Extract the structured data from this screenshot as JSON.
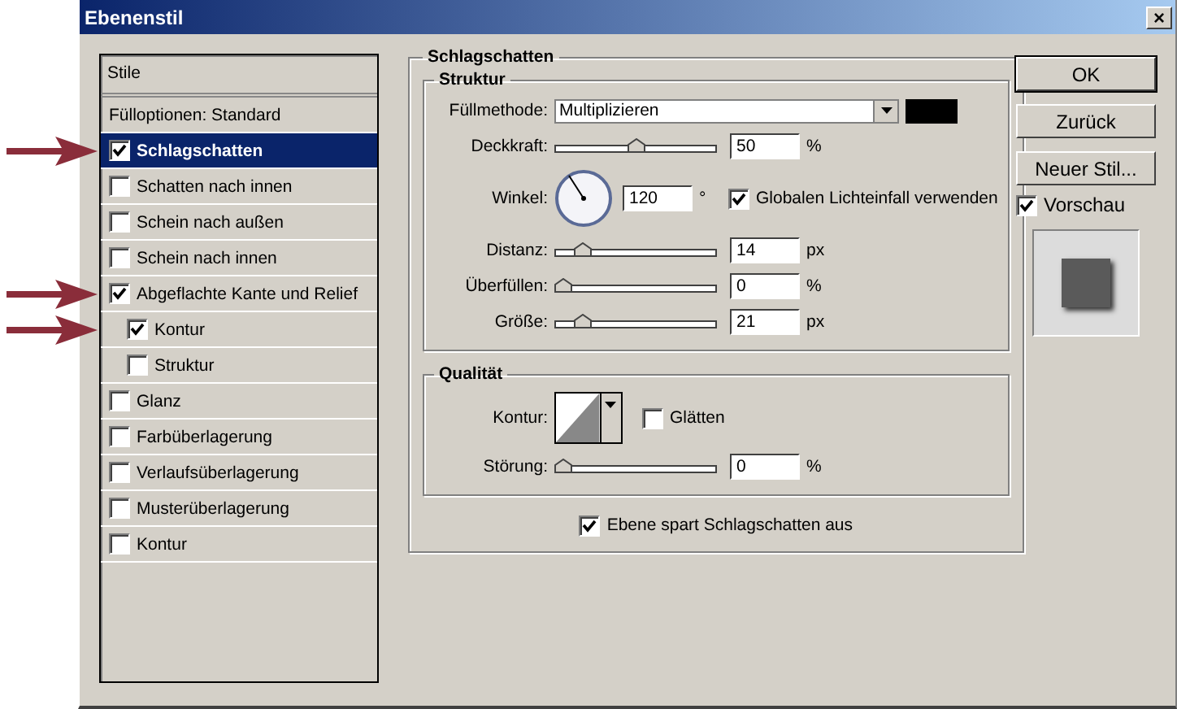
{
  "window": {
    "title": "Ebenenstil",
    "close": "×"
  },
  "styles": {
    "header": "Stile",
    "items": [
      {
        "label": "Fülloptionen: Standard",
        "kind": "plain",
        "selected": false,
        "arrow": false
      },
      {
        "label": "Schlagschatten",
        "kind": "check",
        "checked": true,
        "selected": true,
        "arrow": true
      },
      {
        "label": "Schatten nach innen",
        "kind": "check",
        "checked": false,
        "selected": false,
        "arrow": false
      },
      {
        "label": "Schein nach außen",
        "kind": "check",
        "checked": false,
        "selected": false,
        "arrow": false
      },
      {
        "label": "Schein nach innen",
        "kind": "check",
        "checked": false,
        "selected": false,
        "arrow": false
      },
      {
        "label": "Abgeflachte Kante und Relief",
        "kind": "check",
        "checked": true,
        "selected": false,
        "arrow": true,
        "children": [
          {
            "label": "Kontur",
            "kind": "check",
            "checked": true,
            "selected": false,
            "arrow": true
          },
          {
            "label": "Struktur",
            "kind": "check",
            "checked": false,
            "selected": false,
            "arrow": false
          }
        ]
      },
      {
        "label": "Glanz",
        "kind": "check",
        "checked": false,
        "selected": false,
        "arrow": false
      },
      {
        "label": "Farbüberlagerung",
        "kind": "check",
        "checked": false,
        "selected": false,
        "arrow": false
      },
      {
        "label": "Verlaufsüberlagerung",
        "kind": "check",
        "checked": false,
        "selected": false,
        "arrow": false
      },
      {
        "label": "Musterüberlagerung",
        "kind": "check",
        "checked": false,
        "selected": false,
        "arrow": false
      },
      {
        "label": "Kontur",
        "kind": "check",
        "checked": false,
        "selected": false,
        "arrow": false
      }
    ]
  },
  "panel": {
    "title": "Schlagschatten",
    "structure": {
      "title": "Struktur",
      "blend_label": "Füllmethode:",
      "blend_value": "Multiplizieren",
      "color": "#000000",
      "opacity": {
        "label": "Deckkraft:",
        "level": 0.5,
        "value": "50",
        "unit": "%"
      },
      "angle": {
        "label": "Winkel:",
        "value": "120",
        "unit": "°",
        "global_label": "Globalen Lichteinfall verwenden",
        "global_checked": true
      },
      "sliders": [
        {
          "label": "Distanz:",
          "level": 0.14,
          "value": "14",
          "unit": "px"
        },
        {
          "label": "Überfüllen:",
          "level": 0,
          "value": "0",
          "unit": "%"
        },
        {
          "label": "Größe:",
          "level": 0.14,
          "value": "21",
          "unit": "px"
        }
      ]
    },
    "quality": {
      "title": "Qualität",
      "contour_label": "Kontur:",
      "smooth_label": "Glätten",
      "smooth_checked": false,
      "noise": {
        "label": "Störung:",
        "level": 0,
        "value": "0",
        "unit": "%"
      }
    },
    "knockout": {
      "label": "Ebene spart Schlagschatten aus",
      "checked": true
    }
  },
  "buttons": [
    {
      "label": "OK",
      "default": true
    },
    {
      "label": "Zurück",
      "default": false
    },
    {
      "label": "Neuer Stil...",
      "default": false
    }
  ],
  "preview": {
    "label": "Vorschau",
    "checked": true
  }
}
